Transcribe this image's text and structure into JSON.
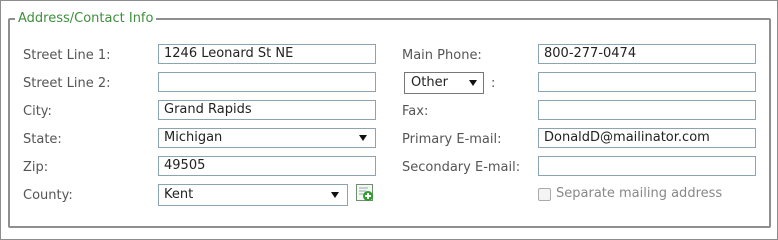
{
  "section": {
    "legend": "Address/Contact Info"
  },
  "labels": {
    "street1": "Street Line 1:",
    "street2": "Street Line 2:",
    "city": "City:",
    "state": "State:",
    "zip": "Zip:",
    "county": "County:",
    "main_phone": "Main Phone:",
    "phone_sep": ":",
    "fax": "Fax:",
    "primary_email": "Primary E-mail:",
    "secondary_email": "Secondary E-mail:",
    "separate_mailing": "Separate mailing address"
  },
  "values": {
    "street1": "1246 Leonard St NE",
    "street2": "",
    "city": "Grand Rapids",
    "state": "Michigan",
    "zip": "49505",
    "county": "Kent",
    "main_phone": "800-277-0474",
    "phone_type": "Other",
    "other_phone": "",
    "fax": "",
    "primary_email": "DonaldD@mailinator.com",
    "secondary_email": "",
    "separate_mailing_checked": false
  },
  "icons": {
    "county_add": "add-county-icon"
  },
  "colors": {
    "legend": "#3f8f3f",
    "input_border": "#8aa4b4",
    "add_icon_green": "#2f9e2f"
  }
}
